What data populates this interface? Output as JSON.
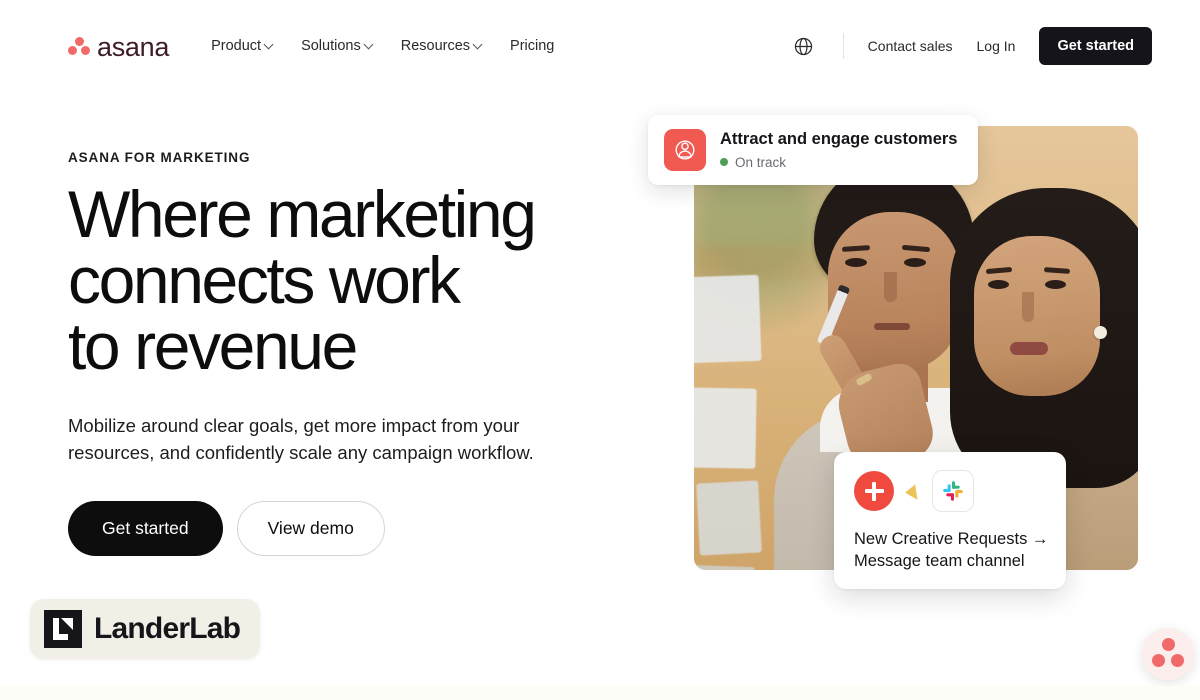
{
  "brand": {
    "name": "asana",
    "logo_icon": "asana-dots-logo",
    "dot_color": "#f06a6a",
    "wordmark_color": "#3d1c27"
  },
  "top_progress": {
    "indicator": "scroll-progress-bar",
    "fill_color": "#6b7f86",
    "track_color": "#eceff1"
  },
  "header": {
    "nav_items": [
      {
        "label": "Product",
        "has_caret": true
      },
      {
        "label": "Solutions",
        "has_caret": true
      },
      {
        "label": "Resources",
        "has_caret": true
      },
      {
        "label": "Pricing",
        "has_caret": false
      }
    ],
    "language_icon": "globe-icon",
    "contact_sales_label": "Contact sales",
    "login_label": "Log In",
    "cta_label": "Get started",
    "cta_bg": "#14141a"
  },
  "hero": {
    "eyebrow": "ASANA FOR MARKETING",
    "headline_lines": [
      "Where marketing",
      "connects work",
      "to revenue"
    ],
    "headline_full": "Where marketing connects work to revenue",
    "subhead": "Mobilize around clear goals, get more impact from your resources, and confidently scale any campaign workflow.",
    "primary_cta": "Get started",
    "secondary_cta": "View demo"
  },
  "media": {
    "alt": "Two colleagues reviewing sticky notes on a glass board in a warm-toned office",
    "goal_card": {
      "icon": "person-target-icon",
      "icon_bg": "#f05a51",
      "title": "Attract and engage customers",
      "status_label": "On track",
      "status_color": "#4f9e55"
    },
    "slack_card": {
      "add_icon": "plus-circle-icon",
      "add_icon_bg": "#f04a3f",
      "spark_icon": "sparkle-icon",
      "integration_icon": "slack-logo-icon",
      "line_1": "New Creative Requests →",
      "line_2": "Message team channel"
    }
  },
  "overlays": {
    "landerlab": {
      "mark_icon": "landerlab-mark-icon",
      "label": "LanderLab",
      "bg": "#f2efe6"
    },
    "chat_widget": {
      "icon": "asana-dots-chat-icon",
      "bg": "#fdeeee",
      "dot_color": "#f06a6a"
    }
  }
}
